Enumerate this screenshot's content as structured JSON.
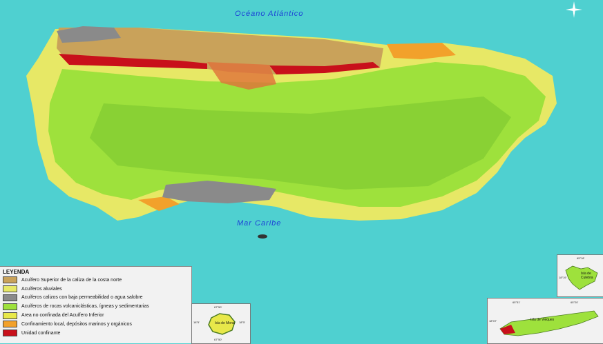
{
  "map": {
    "ocean_north_label": "Océano Atlántico",
    "sea_south_label": "Mar Caribe"
  },
  "legend": {
    "title": "LEYENDA",
    "items": [
      {
        "label": "Acuífero Superior de la caliza de la costa norte",
        "color": "#c9a25a"
      },
      {
        "label": "Acuíferos aluviales",
        "color": "#e7e866"
      },
      {
        "label": "Acuíferos calizos con baja permeabilidad o agua salobre",
        "color": "#8a8a8a"
      },
      {
        "label": "Acuíferos de rocas volcaniclásticas, ígneas y sedimentarias",
        "color": "#9ee13c"
      },
      {
        "label": "Area no confinada del Acuífero Inferior",
        "color": "#e8e84a"
      },
      {
        "label": "Confinamiento local, depósitos marinos y orgánicos",
        "color": "#f2a12b"
      },
      {
        "label": "Unidad confinante",
        "color": "#c8101b"
      }
    ]
  },
  "insets": {
    "mona": {
      "label": "Isla de Mona",
      "top_coord": "67°50'",
      "left_coord": "18°5'",
      "right_coord": "18°5'",
      "bottom_coord": "67°50'"
    },
    "culebra": {
      "label": "Isla de Culebra",
      "top_coord": "65°18'",
      "side_coord": "18°19'"
    },
    "vieques": {
      "label": "Isla de Vieques",
      "top_coord_1": "65°31'",
      "top_coord_2": "65°20'",
      "side_coord": "18°07'"
    }
  },
  "colors": {
    "ocean": "#4fd0d0",
    "volcanic_green": "#9ee13c",
    "alluvial_yellow": "#e7e866",
    "limestone_brown": "#c9a25a",
    "confining_red": "#c8101b",
    "orange": "#f2a12b",
    "gray": "#8a8a8a"
  }
}
